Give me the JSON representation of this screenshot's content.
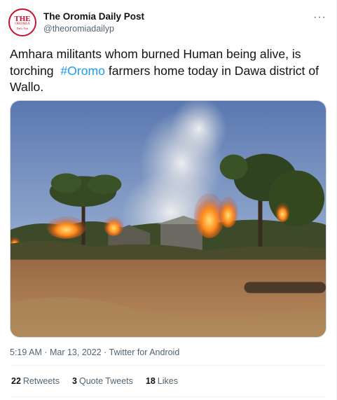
{
  "author": {
    "display_name": "The Oromia Daily Post",
    "handle": "@theoromiadailyp",
    "avatar_text": [
      "THE",
      "OROMIA",
      "Daily Post"
    ]
  },
  "tweet": {
    "text_before": "Amhara militants whom burned Human being alive, is torching  ",
    "hashtag": "#Oromo",
    "text_after": " farmers home today in Dawa district of Wallo."
  },
  "meta": {
    "time": "5:19 AM",
    "sep1": " · ",
    "date": "Mar 13, 2022",
    "sep2": " · ",
    "source": "Twitter for Android"
  },
  "stats": {
    "retweets_count": "22",
    "retweets_label": "Retweets",
    "quotes_count": "3",
    "quotes_label": "Quote Tweets",
    "likes_count": "18",
    "likes_label": "Likes"
  },
  "icons": {
    "more": "more-icon"
  },
  "colors": {
    "accent": "#1d9bf0",
    "secondary_text": "#536471",
    "brand_red": "#c8102e"
  }
}
